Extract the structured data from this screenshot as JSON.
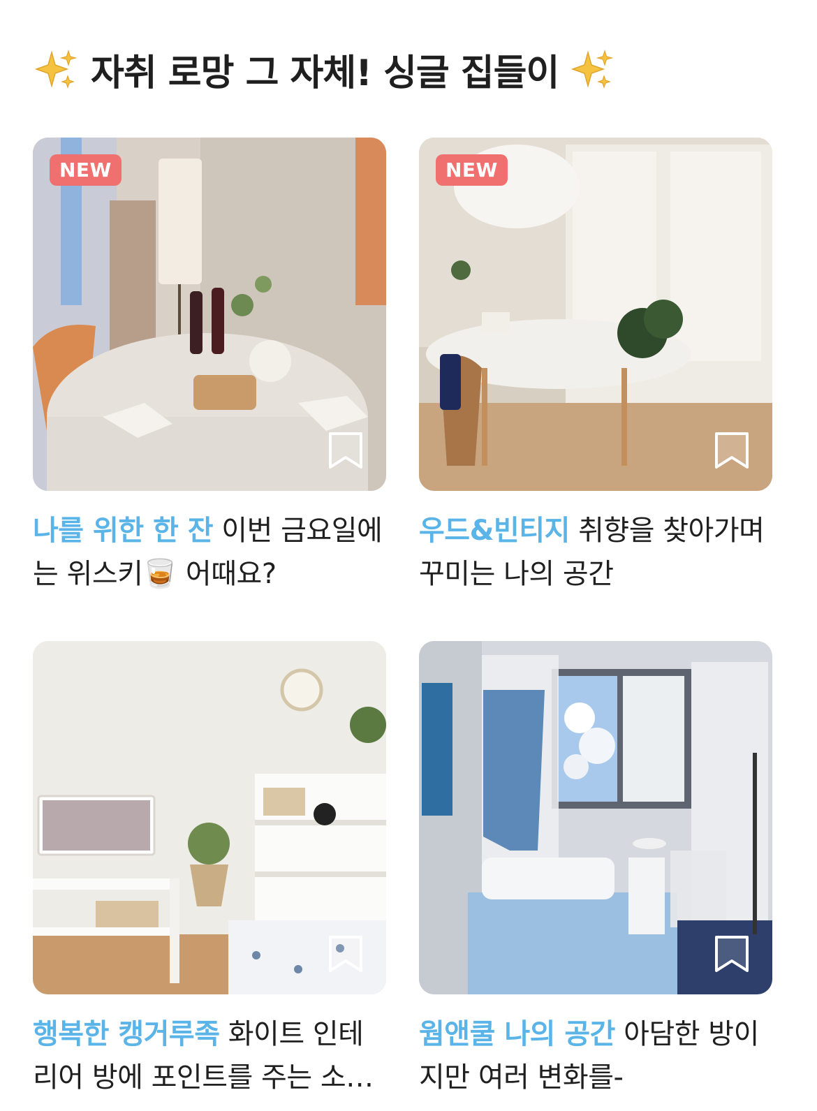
{
  "section": {
    "title": "자취 로망 그 자체! 싱글 집들이"
  },
  "colors": {
    "accent": "#5ab4e8",
    "badge": "#f07070"
  },
  "cards": [
    {
      "badge": "NEW",
      "tag": "나를 위한 한 잔",
      "text": " 이번 금요일에는 위스키🥃 어때요?",
      "bookmark_icon": "bookmark-icon"
    },
    {
      "badge": "NEW",
      "tag": "우드&빈티지",
      "text": " 취향을 찾아가며 꾸미는 나의 공간",
      "bookmark_icon": "bookmark-icon"
    },
    {
      "badge": "",
      "tag": "행복한 캥거루족",
      "text": "  화이트 인테리어 방에 포인트를 주는 소품들",
      "bookmark_icon": "bookmark-icon"
    },
    {
      "badge": "",
      "tag": "웜앤쿨 나의 공간",
      "text": " 아담한 방이지만 여러 변화를-",
      "bookmark_icon": "bookmark-icon"
    }
  ]
}
